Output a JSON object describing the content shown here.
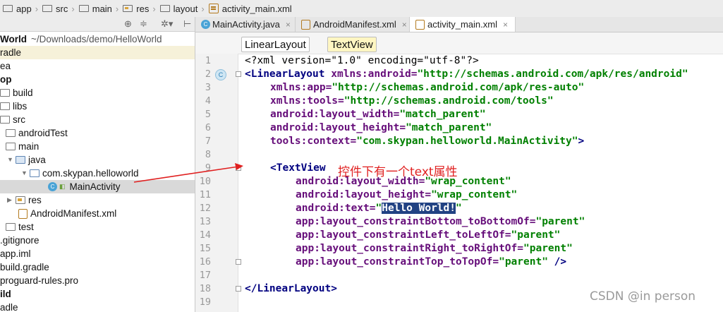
{
  "breadcrumb": [
    "app",
    "src",
    "main",
    "res",
    "layout",
    "activity_main.xml"
  ],
  "tabs": [
    {
      "label": "MainActivity.java",
      "close": "×"
    },
    {
      "label": "AndroidManifest.xml",
      "close": "×"
    },
    {
      "label": "activity_main.xml",
      "close": "×"
    }
  ],
  "structure": [
    "LinearLayout",
    "TextView"
  ],
  "project_tree": [
    {
      "label": "World",
      "extra": "~/Downloads/demo/HelloWorld"
    },
    {
      "label": "radle"
    },
    {
      "label": "ea"
    },
    {
      "label": "op"
    },
    {
      "label": "build"
    },
    {
      "label": "libs"
    },
    {
      "label": "src"
    },
    {
      "label": "androidTest"
    },
    {
      "label": "main"
    },
    {
      "label": "java"
    },
    {
      "label": "com.skypan.helloworld"
    },
    {
      "label": "MainActivity"
    },
    {
      "label": "res"
    },
    {
      "label": "AndroidManifest.xml"
    },
    {
      "label": "test"
    },
    {
      "label": ".gitignore"
    },
    {
      "label": "app.iml"
    },
    {
      "label": "build.gradle"
    },
    {
      "label": "proguard-rules.pro"
    },
    {
      "label": "ild"
    },
    {
      "label": "adle"
    }
  ],
  "line_numbers": [
    "1",
    "2",
    "3",
    "4",
    "5",
    "6",
    "7",
    "8",
    "9",
    "10",
    "11",
    "12",
    "13",
    "14",
    "15",
    "16",
    "17",
    "18",
    "19"
  ],
  "code": {
    "l1": "<?xml version=\"1.0\" encoding=\"utf-8\"?>",
    "l2_tag": "<LinearLayout",
    "l2_attr": " xmlns:android=",
    "l2_val": "\"http://schemas.android.com/apk/res/android\"",
    "l3_attr": "xmlns:app=",
    "l3_val": "\"http://schemas.android.com/apk/res-auto\"",
    "l4_attr": "xmlns:tools=",
    "l4_val": "\"http://schemas.android.com/tools\"",
    "l5_attr": "android:layout_width=",
    "l5_val": "\"match_parent\"",
    "l6_attr": "android:layout_height=",
    "l6_val": "\"match_parent\"",
    "l7_attr": "tools:context=",
    "l7_val": "\"com.skypan.helloworld.MainActivity\"",
    "l7_end": ">",
    "l9_tag": "<TextView",
    "l10_attr": "android:layout_width=",
    "l10_val": "\"wrap_content\"",
    "l11_attr": "android:layout_height=",
    "l11_val": "\"wrap_content\"",
    "l12_attr": "android:text=",
    "l12_q1": "\"",
    "l12_sel": "Hello World!",
    "l12_q2": "\"",
    "l13_attr": "app:layout_constraintBottom_toBottomOf=",
    "l13_val": "\"parent\"",
    "l14_attr": "app:layout_constraintLeft_toLeftOf=",
    "l14_val": "\"parent\"",
    "l15_attr": "app:layout_constraintRight_toRightOf=",
    "l15_val": "\"parent\"",
    "l16_attr": "app:layout_constraintTop_toTopOf=",
    "l16_val": "\"parent\"",
    "l16_end": " />",
    "l18_tag": "</LinearLayout>"
  },
  "annotation": "控件下有一个text属性",
  "class_marker": "C",
  "watermark": "CSDN @in person",
  "colors": {
    "annotation": "#e02020",
    "selection": "#214283",
    "attribute": "#660e7a",
    "value": "#008000",
    "tag": "#000080"
  },
  "icons": [
    "folder-icon",
    "xml-file-icon",
    "class-icon",
    "close-icon",
    "gear-icon",
    "collapse-icon",
    "target-icon"
  ]
}
